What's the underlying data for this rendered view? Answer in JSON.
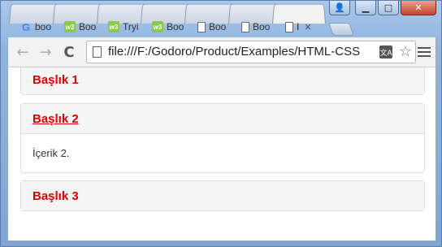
{
  "window": {
    "controls": {
      "user": "👤",
      "minimize": "▁",
      "maximize": "□",
      "close": "✕"
    }
  },
  "tabs": [
    {
      "label": "boo",
      "icon": "google-icon",
      "glyph": "G"
    },
    {
      "label": "Boo",
      "icon": "w3-icon",
      "glyph": "w3"
    },
    {
      "label": "Tryi",
      "icon": "w3-icon",
      "glyph": "w3"
    },
    {
      "label": "Boo",
      "icon": "w3-icon",
      "glyph": "w3"
    },
    {
      "label": "Boo",
      "icon": "document-icon",
      "glyph": ""
    },
    {
      "label": "Boo",
      "icon": "document-icon",
      "glyph": ""
    },
    {
      "label": "I",
      "icon": "document-icon",
      "glyph": "",
      "active": true,
      "close": "✕"
    }
  ],
  "toolbar": {
    "back": "←",
    "forward": "→",
    "reload": "C",
    "url": "file:///F:/Godoro/Product/Examples/HTML-CSS",
    "translate": "文A",
    "star": "☆"
  },
  "page": {
    "panels": [
      {
        "heading": "Başlık 1",
        "body": ""
      },
      {
        "heading": "Başlık 2",
        "body": "İçerik 2."
      },
      {
        "heading": "Başlık 3",
        "body": ""
      }
    ]
  },
  "colors": {
    "heading_text": "#e00000",
    "panel_heading_bg": "#f5f5f5",
    "panel_border": "#dddddd"
  }
}
